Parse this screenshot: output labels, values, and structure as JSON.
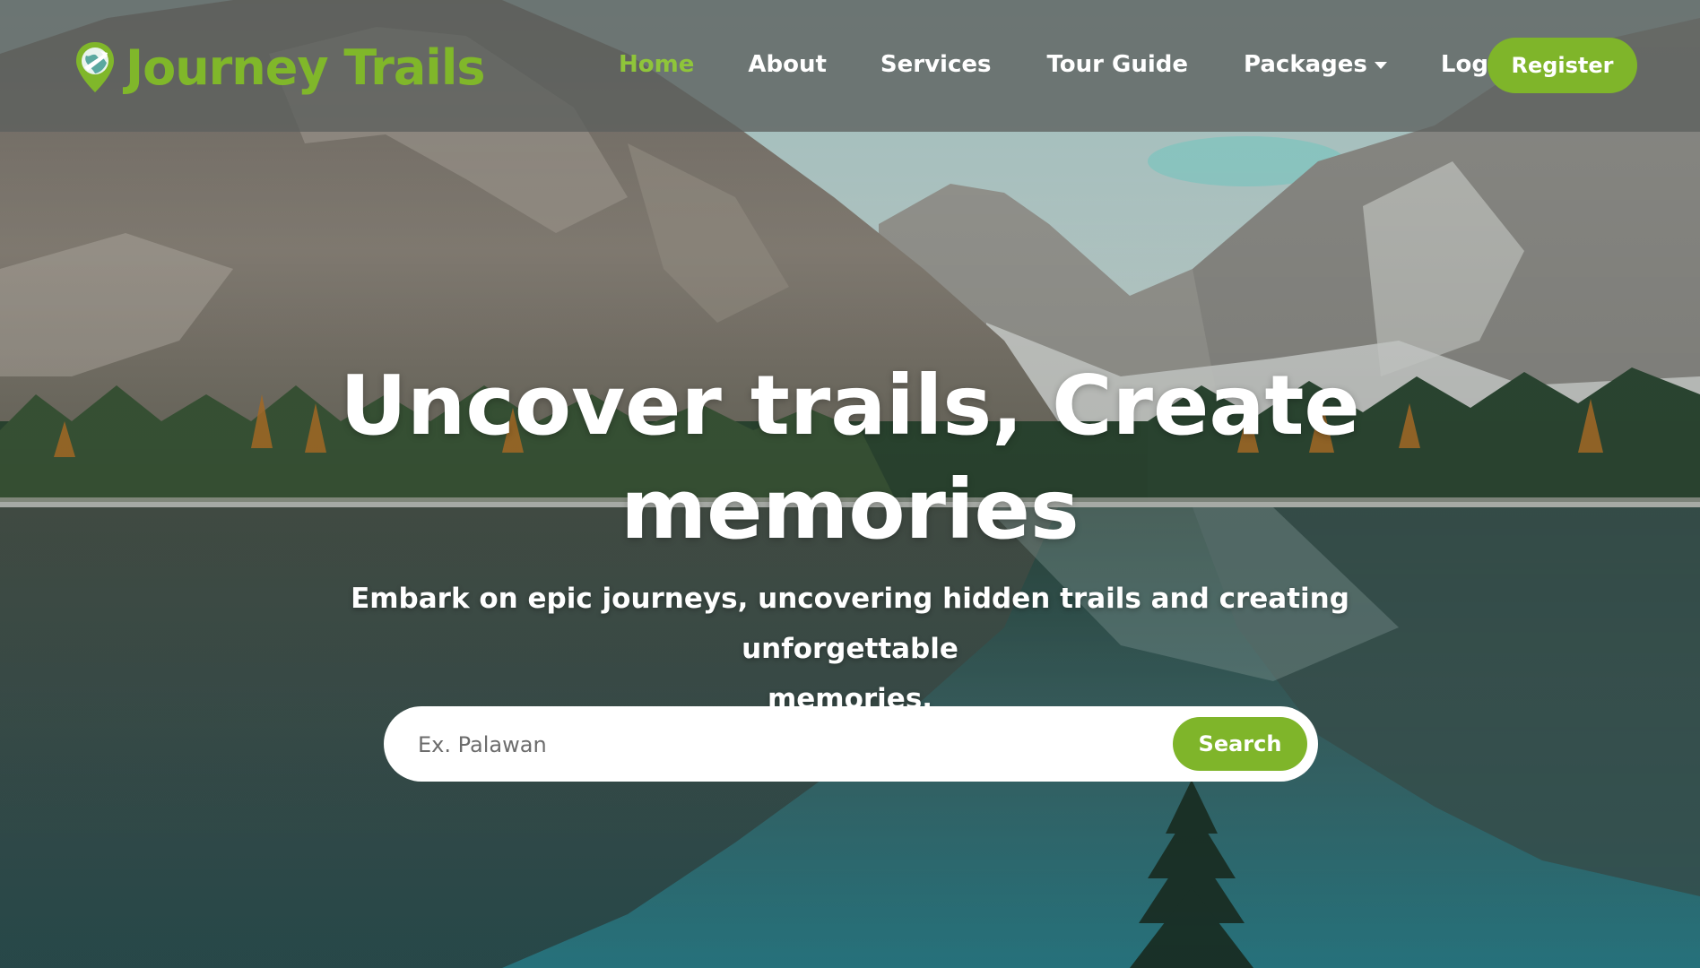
{
  "brand": {
    "name": "Journey Trails",
    "logo_icon": "map-pin-globe-icon",
    "color": "#80b72a"
  },
  "nav": {
    "items": [
      {
        "label": "Home",
        "active": true
      },
      {
        "label": "About",
        "active": false
      },
      {
        "label": "Services",
        "active": false
      },
      {
        "label": "Tour Guide",
        "active": false
      },
      {
        "label": "Packages",
        "active": false,
        "dropdown": true
      },
      {
        "label": "Log in",
        "active": false
      }
    ],
    "register_label": "Register",
    "active_color": "#8fc53a"
  },
  "hero": {
    "title_line1": "Uncover trails, Create",
    "title_line2": "memories",
    "subtitle_line1": "Embark on epic journeys, uncovering hidden trails and creating unforgettable",
    "subtitle_line2": "memories.",
    "background": "mountain-lake-reflection-photo"
  },
  "search": {
    "placeholder": "Ex. Palawan",
    "value": "",
    "button_label": "Search",
    "icon": "none"
  },
  "colors": {
    "accent": "#7fb52a",
    "navbar_bg": "#5c605e"
  }
}
